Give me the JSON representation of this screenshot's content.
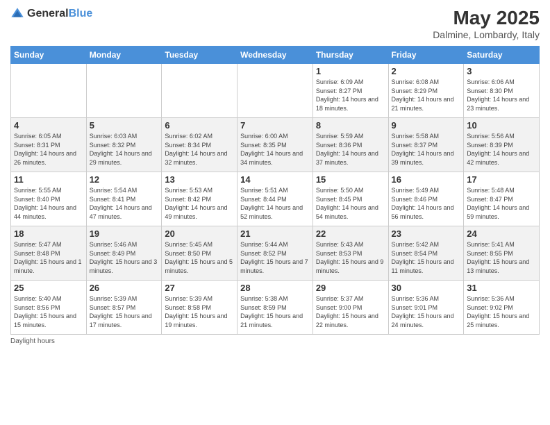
{
  "header": {
    "logo_general": "General",
    "logo_blue": "Blue",
    "title": "May 2025",
    "subtitle": "Dalmine, Lombardy, Italy"
  },
  "days_of_week": [
    "Sunday",
    "Monday",
    "Tuesday",
    "Wednesday",
    "Thursday",
    "Friday",
    "Saturday"
  ],
  "weeks": [
    [
      {
        "day": "",
        "info": ""
      },
      {
        "day": "",
        "info": ""
      },
      {
        "day": "",
        "info": ""
      },
      {
        "day": "",
        "info": ""
      },
      {
        "day": "1",
        "info": "Sunrise: 6:09 AM\nSunset: 8:27 PM\nDaylight: 14 hours and 18 minutes."
      },
      {
        "day": "2",
        "info": "Sunrise: 6:08 AM\nSunset: 8:29 PM\nDaylight: 14 hours and 21 minutes."
      },
      {
        "day": "3",
        "info": "Sunrise: 6:06 AM\nSunset: 8:30 PM\nDaylight: 14 hours and 23 minutes."
      }
    ],
    [
      {
        "day": "4",
        "info": "Sunrise: 6:05 AM\nSunset: 8:31 PM\nDaylight: 14 hours and 26 minutes."
      },
      {
        "day": "5",
        "info": "Sunrise: 6:03 AM\nSunset: 8:32 PM\nDaylight: 14 hours and 29 minutes."
      },
      {
        "day": "6",
        "info": "Sunrise: 6:02 AM\nSunset: 8:34 PM\nDaylight: 14 hours and 32 minutes."
      },
      {
        "day": "7",
        "info": "Sunrise: 6:00 AM\nSunset: 8:35 PM\nDaylight: 14 hours and 34 minutes."
      },
      {
        "day": "8",
        "info": "Sunrise: 5:59 AM\nSunset: 8:36 PM\nDaylight: 14 hours and 37 minutes."
      },
      {
        "day": "9",
        "info": "Sunrise: 5:58 AM\nSunset: 8:37 PM\nDaylight: 14 hours and 39 minutes."
      },
      {
        "day": "10",
        "info": "Sunrise: 5:56 AM\nSunset: 8:39 PM\nDaylight: 14 hours and 42 minutes."
      }
    ],
    [
      {
        "day": "11",
        "info": "Sunrise: 5:55 AM\nSunset: 8:40 PM\nDaylight: 14 hours and 44 minutes."
      },
      {
        "day": "12",
        "info": "Sunrise: 5:54 AM\nSunset: 8:41 PM\nDaylight: 14 hours and 47 minutes."
      },
      {
        "day": "13",
        "info": "Sunrise: 5:53 AM\nSunset: 8:42 PM\nDaylight: 14 hours and 49 minutes."
      },
      {
        "day": "14",
        "info": "Sunrise: 5:51 AM\nSunset: 8:44 PM\nDaylight: 14 hours and 52 minutes."
      },
      {
        "day": "15",
        "info": "Sunrise: 5:50 AM\nSunset: 8:45 PM\nDaylight: 14 hours and 54 minutes."
      },
      {
        "day": "16",
        "info": "Sunrise: 5:49 AM\nSunset: 8:46 PM\nDaylight: 14 hours and 56 minutes."
      },
      {
        "day": "17",
        "info": "Sunrise: 5:48 AM\nSunset: 8:47 PM\nDaylight: 14 hours and 59 minutes."
      }
    ],
    [
      {
        "day": "18",
        "info": "Sunrise: 5:47 AM\nSunset: 8:48 PM\nDaylight: 15 hours and 1 minute."
      },
      {
        "day": "19",
        "info": "Sunrise: 5:46 AM\nSunset: 8:49 PM\nDaylight: 15 hours and 3 minutes."
      },
      {
        "day": "20",
        "info": "Sunrise: 5:45 AM\nSunset: 8:50 PM\nDaylight: 15 hours and 5 minutes."
      },
      {
        "day": "21",
        "info": "Sunrise: 5:44 AM\nSunset: 8:52 PM\nDaylight: 15 hours and 7 minutes."
      },
      {
        "day": "22",
        "info": "Sunrise: 5:43 AM\nSunset: 8:53 PM\nDaylight: 15 hours and 9 minutes."
      },
      {
        "day": "23",
        "info": "Sunrise: 5:42 AM\nSunset: 8:54 PM\nDaylight: 15 hours and 11 minutes."
      },
      {
        "day": "24",
        "info": "Sunrise: 5:41 AM\nSunset: 8:55 PM\nDaylight: 15 hours and 13 minutes."
      }
    ],
    [
      {
        "day": "25",
        "info": "Sunrise: 5:40 AM\nSunset: 8:56 PM\nDaylight: 15 hours and 15 minutes."
      },
      {
        "day": "26",
        "info": "Sunrise: 5:39 AM\nSunset: 8:57 PM\nDaylight: 15 hours and 17 minutes."
      },
      {
        "day": "27",
        "info": "Sunrise: 5:39 AM\nSunset: 8:58 PM\nDaylight: 15 hours and 19 minutes."
      },
      {
        "day": "28",
        "info": "Sunrise: 5:38 AM\nSunset: 8:59 PM\nDaylight: 15 hours and 21 minutes."
      },
      {
        "day": "29",
        "info": "Sunrise: 5:37 AM\nSunset: 9:00 PM\nDaylight: 15 hours and 22 minutes."
      },
      {
        "day": "30",
        "info": "Sunrise: 5:36 AM\nSunset: 9:01 PM\nDaylight: 15 hours and 24 minutes."
      },
      {
        "day": "31",
        "info": "Sunrise: 5:36 AM\nSunset: 9:02 PM\nDaylight: 15 hours and 25 minutes."
      }
    ]
  ],
  "footer": {
    "daylight_label": "Daylight hours"
  }
}
